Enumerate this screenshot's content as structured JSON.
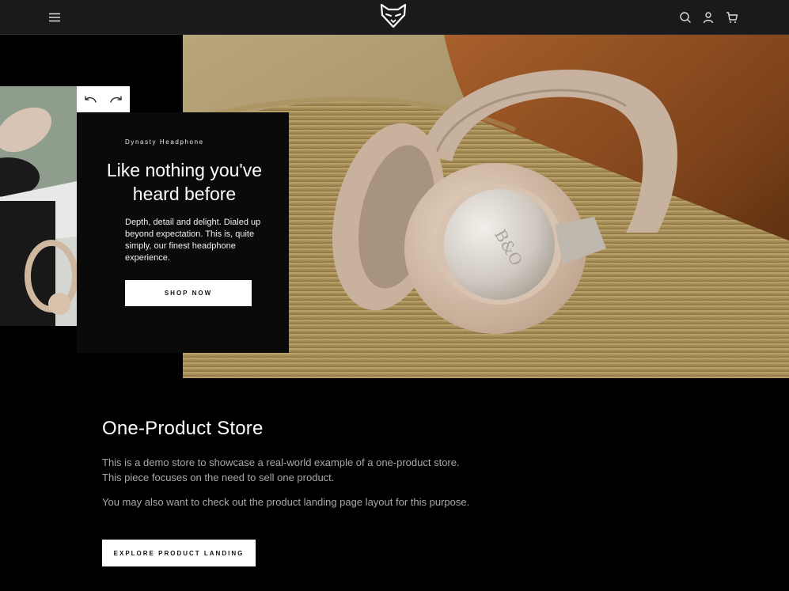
{
  "header": {
    "menu_icon": "hamburger-menu-icon",
    "logo_icon": "fox-logo-icon",
    "search_icon": "search-icon",
    "account_icon": "user-icon",
    "cart_icon": "cart-icon"
  },
  "hero": {
    "eyebrow": "Dynasty Headphone",
    "title": "Like nothing you've heard before",
    "description": "Depth, detail and delight. Dialed up beyond expectation. This is, quite simply, our finest headphone experience.",
    "cta_label": "SHOP NOW",
    "prev_icon": "arrow-left-icon",
    "next_icon": "arrow-right-icon",
    "product_mark": "B&O"
  },
  "content": {
    "title": "One-Product Store",
    "paragraph1": "This is a demo store to showcase a real-world example of a one-product store. This piece focuses on the need to sell one product.",
    "paragraph2": "You may also want to check out the product landing page layout for this purpose.",
    "cta_label": "EXPLORE PRODUCT LANDING"
  },
  "colors": {
    "header_bg": "#1a1a1c",
    "page_bg": "#000000",
    "button_bg": "#ffffff",
    "body_text_muted": "#a8a8a8"
  }
}
